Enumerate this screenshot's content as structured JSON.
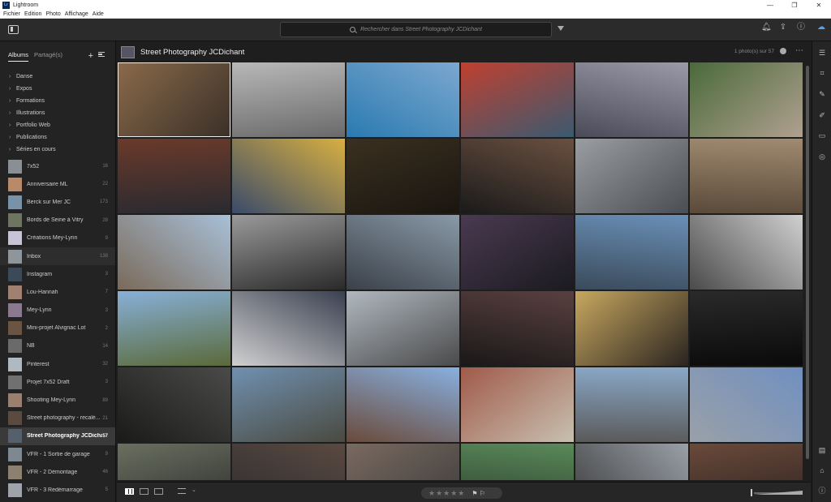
{
  "window": {
    "title": "Lightroom",
    "app_icon": "Lr",
    "controls": [
      "—",
      "❐",
      "✕"
    ]
  },
  "menu": [
    "Fichier",
    "Edition",
    "Photo",
    "Affichage",
    "Aide"
  ],
  "search": {
    "placeholder": "Rechercher dans Street Photography JCDichant"
  },
  "sidebar": {
    "tabs": [
      {
        "label": "Albums",
        "active": true
      },
      {
        "label": "Partagé(s)",
        "active": false
      }
    ],
    "folders": [
      "Danse",
      "Expos",
      "Formations",
      "Illustrations",
      "Portfolio Web",
      "Publications",
      "Séries en cours"
    ],
    "albums": [
      {
        "name": "7x52",
        "count": "16",
        "color": "#8a8f96"
      },
      {
        "name": "Anniversaire ML",
        "count": "22",
        "color": "#b88a6a"
      },
      {
        "name": "Berck sur Mer JC",
        "count": "173",
        "color": "#7893a8"
      },
      {
        "name": "Bords de Seine à Vitry",
        "count": "28",
        "color": "#6d7560"
      },
      {
        "name": "Créations Mey-Lynn",
        "count": "9",
        "color": "#c8c4d8"
      },
      {
        "name": "Inbox",
        "count": "138",
        "color": "#8e959b"
      },
      {
        "name": "Instagram",
        "count": "3",
        "color": "#3c4a58"
      },
      {
        "name": "Lou-Hannah",
        "count": "7",
        "color": "#a08070"
      },
      {
        "name": "Mey-Lynn",
        "count": "3",
        "color": "#8a7a90"
      },
      {
        "name": "Mini-projet Alvignac Lot",
        "count": "2",
        "color": "#6a5544"
      },
      {
        "name": "NB",
        "count": "14",
        "color": "#6a6a6a"
      },
      {
        "name": "Pinterest",
        "count": "32",
        "color": "#b0b8c0"
      },
      {
        "name": "Projet 7x52 Draft",
        "count": "3",
        "color": "#707070"
      },
      {
        "name": "Shooting Mey-Lynn",
        "count": "89",
        "color": "#9a7e6e"
      },
      {
        "name": "Street photography - recalé...",
        "count": "21",
        "color": "#5a4a40"
      },
      {
        "name": "Street Photography JCDichant",
        "count": "57",
        "color": "#55606c"
      },
      {
        "name": "VFR - 1 Sortie de garage",
        "count": "9",
        "color": "#7e8890"
      },
      {
        "name": "VFR - 2 Démontage",
        "count": "46",
        "color": "#8c8070"
      },
      {
        "name": "VFR - 3 Redémarrage",
        "count": "5",
        "color": "#9ea4aa"
      }
    ]
  },
  "album_view": {
    "title": "Street Photography JCDichant",
    "photo_count": "1 photo(s) sur 57"
  },
  "photos": [
    [
      "#8a6a4a",
      "#3a3028"
    ],
    [
      "#b8b8b8",
      "#6a6a6a"
    ],
    [
      "#7ca8d0",
      "#2a7ab0"
    ],
    [
      "#c04030",
      "#3a5a70"
    ],
    [
      "#9a9aa8",
      "#4a4a58"
    ],
    [
      "#4a6a3a",
      "#b0a090"
    ],
    [
      "#6a3a2a",
      "#2a2a30"
    ],
    [
      "#d8b040",
      "#3a4a6a"
    ],
    [
      "#3a3020",
      "#1a1510"
    ],
    [
      "#6a5040",
      "#1a1a1a"
    ],
    [
      "#9a9ea2",
      "#4a4e52"
    ],
    [
      "#a08a70",
      "#5a4a3a"
    ],
    [
      "#a8c0d8",
      "#7a6a5a"
    ],
    [
      "#9a9a9a",
      "#2a2a2a"
    ],
    [
      "#8a9aa8",
      "#3a4048"
    ],
    [
      "#4a3a50",
      "#1a1a20"
    ],
    [
      "#6a90b8",
      "#3a4a5a"
    ],
    [
      "#d0d0d0",
      "#4a4a4a"
    ],
    [
      "#88b0d8",
      "#5a6a3a"
    ],
    [
      "#3a4050",
      "#d0d0d0"
    ],
    [
      "#b0b8c0",
      "#4a4a4a"
    ],
    [
      "#5a4040",
      "#1a1818"
    ],
    [
      "#c8a860",
      "#2a2420"
    ],
    [
      "#2a2a2a",
      "#0a0a0a"
    ],
    [
      "#4a4a48",
      "#1a1a18"
    ],
    [
      "#7090b0",
      "#4a4a40"
    ],
    [
      "#88b0e0",
      "#6a4a3a"
    ],
    [
      "#a05a4a",
      "#c8c0b0"
    ],
    [
      "#8aa8c8",
      "#5a5a5a"
    ],
    [
      "#7090c0",
      "#9aa0a8"
    ],
    [
      "#6a7060",
      "#2a2a2a"
    ],
    [
      "#5a4a40",
      "#2a2a30"
    ],
    [
      "#7a6a60",
      "#3a3a3a"
    ],
    [
      "#5a8a5a",
      "#2a3a2a"
    ],
    [
      "#9aa0a8",
      "#3a3a3a"
    ],
    [
      "#6a4a3a",
      "#2a2020"
    ]
  ],
  "bottom": {
    "stars": "★★★★★",
    "flags": "⚑ ⚐"
  }
}
